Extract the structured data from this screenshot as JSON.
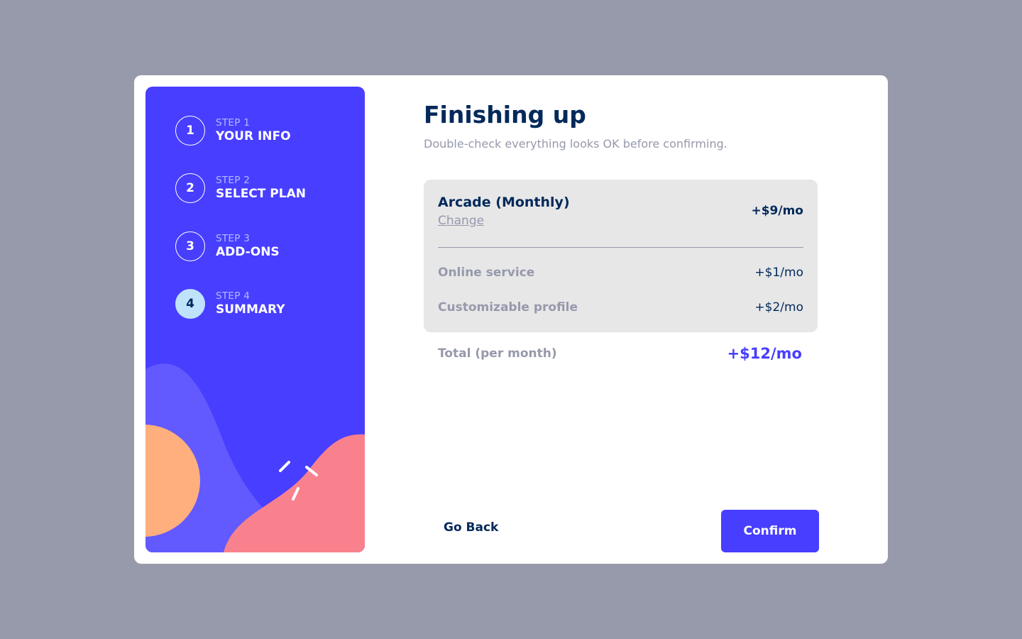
{
  "sidebar": {
    "steps": [
      {
        "number": "1",
        "sub": "STEP 1",
        "label": "YOUR INFO",
        "active": false
      },
      {
        "number": "2",
        "sub": "STEP 2",
        "label": "SELECT PLAN",
        "active": false
      },
      {
        "number": "3",
        "sub": "STEP 3",
        "label": "ADD-ONS",
        "active": false
      },
      {
        "number": "4",
        "sub": "STEP 4",
        "label": "SUMMARY",
        "active": true
      }
    ]
  },
  "main": {
    "title": "Finishing up",
    "subtitle": "Double-check everything looks OK before confirming.",
    "plan": {
      "name": "Arcade (Monthly)",
      "change_label": "Change",
      "price": "+$9/mo"
    },
    "addons": [
      {
        "name": "Online service",
        "price": "+$1/mo"
      },
      {
        "name": "Customizable profile",
        "price": "+$2/mo"
      }
    ],
    "total": {
      "label": "Total (per month)",
      "price": "+$12/mo"
    },
    "back_label": "Go Back",
    "confirm_label": "Confirm"
  },
  "colors": {
    "accent": "#483eff",
    "dark_blue": "#02295a",
    "gray_text": "#9699ab",
    "active_step": "#bfe2fd",
    "backdrop": "#979aab"
  }
}
